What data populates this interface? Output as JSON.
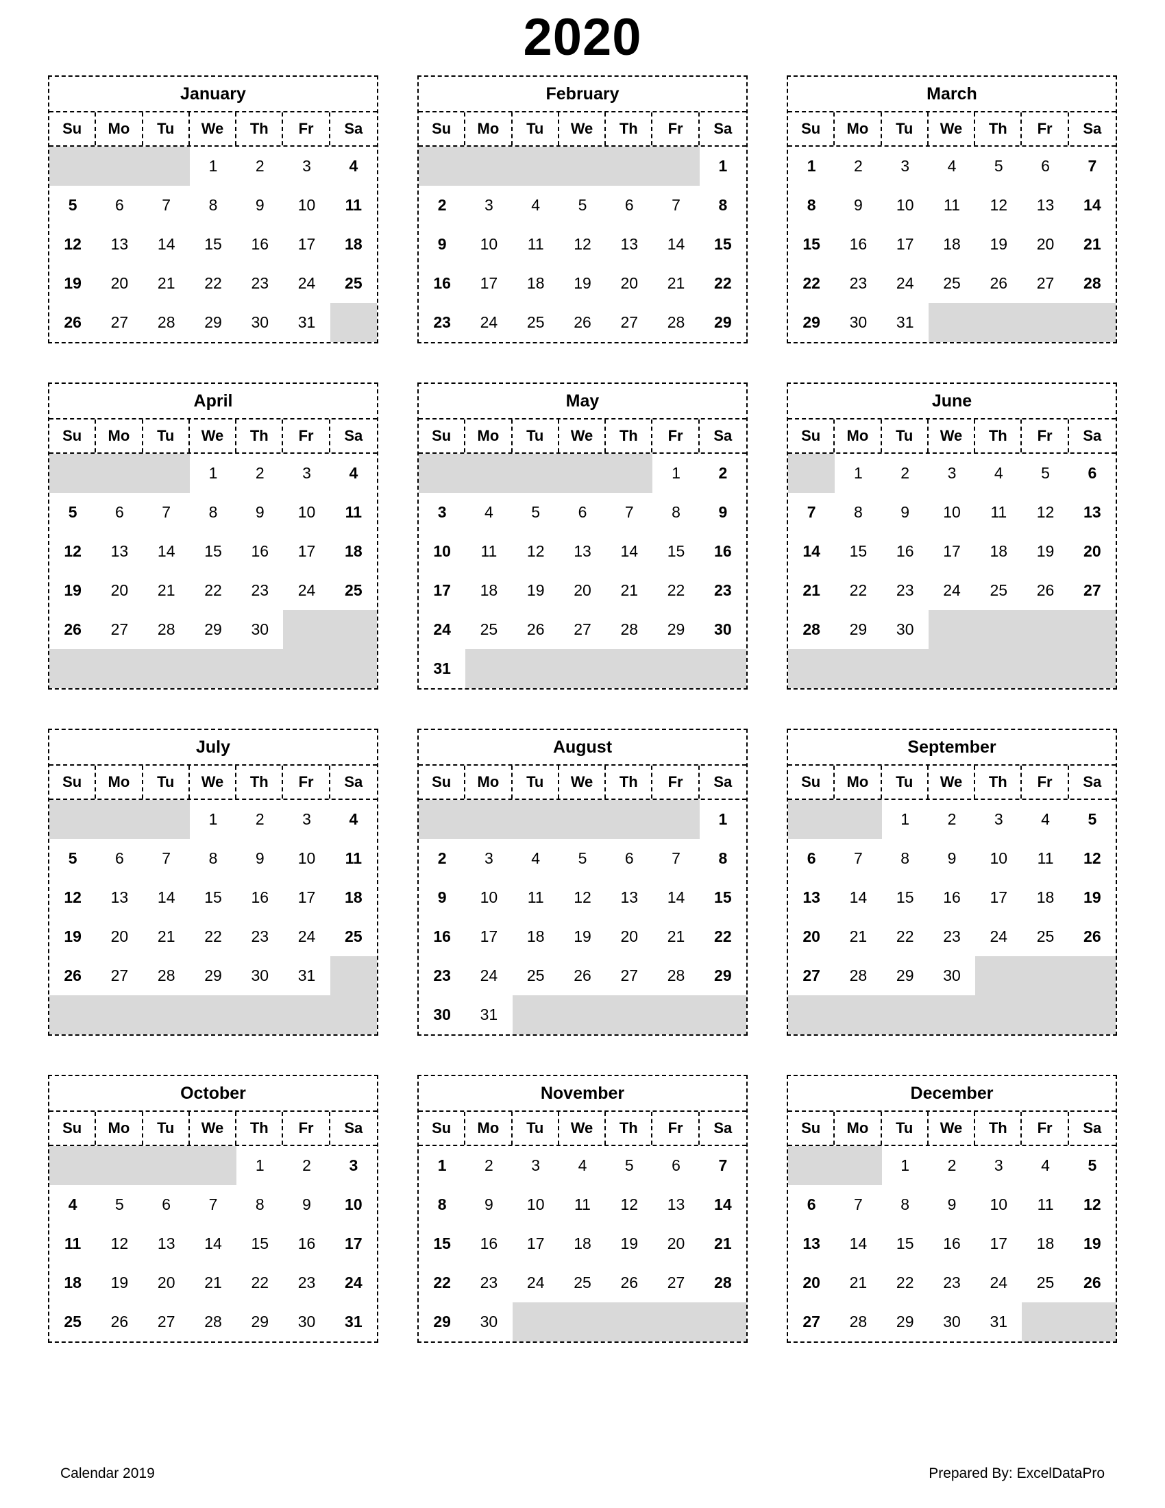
{
  "title": "2020",
  "footer": {
    "left_text": "Calendar 2019",
    "right_text": "Prepared By: ExcelDataPro"
  },
  "colors": {
    "blank_cell": "#d9d9d9",
    "text": "#000000",
    "background": "#ffffff",
    "border": "#000000"
  },
  "weekday_headers": [
    "Su",
    "Mo",
    "Tu",
    "We",
    "Th",
    "Fr",
    "Sa"
  ],
  "weekend_columns": [
    0,
    6
  ],
  "months": [
    {
      "name": "January",
      "weeks": [
        [
          "",
          "",
          "",
          "1",
          "2",
          "3",
          "4"
        ],
        [
          "5",
          "6",
          "7",
          "8",
          "9",
          "10",
          "11"
        ],
        [
          "12",
          "13",
          "14",
          "15",
          "16",
          "17",
          "18"
        ],
        [
          "19",
          "20",
          "21",
          "22",
          "23",
          "24",
          "25"
        ],
        [
          "26",
          "27",
          "28",
          "29",
          "30",
          "31",
          ""
        ]
      ]
    },
    {
      "name": "February",
      "weeks": [
        [
          "",
          "",
          "",
          "",
          "",
          "",
          "1"
        ],
        [
          "2",
          "3",
          "4",
          "5",
          "6",
          "7",
          "8"
        ],
        [
          "9",
          "10",
          "11",
          "12",
          "13",
          "14",
          "15"
        ],
        [
          "16",
          "17",
          "18",
          "19",
          "20",
          "21",
          "22"
        ],
        [
          "23",
          "24",
          "25",
          "26",
          "27",
          "28",
          "29"
        ]
      ]
    },
    {
      "name": "March",
      "weeks": [
        [
          "1",
          "2",
          "3",
          "4",
          "5",
          "6",
          "7"
        ],
        [
          "8",
          "9",
          "10",
          "11",
          "12",
          "13",
          "14"
        ],
        [
          "15",
          "16",
          "17",
          "18",
          "19",
          "20",
          "21"
        ],
        [
          "22",
          "23",
          "24",
          "25",
          "26",
          "27",
          "28"
        ],
        [
          "29",
          "30",
          "31",
          "",
          "",
          "",
          ""
        ]
      ]
    },
    {
      "name": "April",
      "weeks": [
        [
          "",
          "",
          "",
          "1",
          "2",
          "3",
          "4"
        ],
        [
          "5",
          "6",
          "7",
          "8",
          "9",
          "10",
          "11"
        ],
        [
          "12",
          "13",
          "14",
          "15",
          "16",
          "17",
          "18"
        ],
        [
          "19",
          "20",
          "21",
          "22",
          "23",
          "24",
          "25"
        ],
        [
          "26",
          "27",
          "28",
          "29",
          "30",
          "",
          ""
        ],
        [
          "",
          "",
          "",
          "",
          "",
          "",
          ""
        ]
      ]
    },
    {
      "name": "May",
      "weeks": [
        [
          "",
          "",
          "",
          "",
          "",
          "1",
          "2"
        ],
        [
          "3",
          "4",
          "5",
          "6",
          "7",
          "8",
          "9"
        ],
        [
          "10",
          "11",
          "12",
          "13",
          "14",
          "15",
          "16"
        ],
        [
          "17",
          "18",
          "19",
          "20",
          "21",
          "22",
          "23"
        ],
        [
          "24",
          "25",
          "26",
          "27",
          "28",
          "29",
          "30"
        ],
        [
          "31",
          "",
          "",
          "",
          "",
          "",
          ""
        ]
      ]
    },
    {
      "name": "June",
      "weeks": [
        [
          "",
          "1",
          "2",
          "3",
          "4",
          "5",
          "6"
        ],
        [
          "7",
          "8",
          "9",
          "10",
          "11",
          "12",
          "13"
        ],
        [
          "14",
          "15",
          "16",
          "17",
          "18",
          "19",
          "20"
        ],
        [
          "21",
          "22",
          "23",
          "24",
          "25",
          "26",
          "27"
        ],
        [
          "28",
          "29",
          "30",
          "",
          "",
          "",
          ""
        ],
        [
          "",
          "",
          "",
          "",
          "",
          "",
          ""
        ]
      ]
    },
    {
      "name": "July",
      "weeks": [
        [
          "",
          "",
          "",
          "1",
          "2",
          "3",
          "4"
        ],
        [
          "5",
          "6",
          "7",
          "8",
          "9",
          "10",
          "11"
        ],
        [
          "12",
          "13",
          "14",
          "15",
          "16",
          "17",
          "18"
        ],
        [
          "19",
          "20",
          "21",
          "22",
          "23",
          "24",
          "25"
        ],
        [
          "26",
          "27",
          "28",
          "29",
          "30",
          "31",
          ""
        ],
        [
          "",
          "",
          "",
          "",
          "",
          "",
          ""
        ]
      ]
    },
    {
      "name": "August",
      "weeks": [
        [
          "",
          "",
          "",
          "",
          "",
          "",
          "1"
        ],
        [
          "2",
          "3",
          "4",
          "5",
          "6",
          "7",
          "8"
        ],
        [
          "9",
          "10",
          "11",
          "12",
          "13",
          "14",
          "15"
        ],
        [
          "16",
          "17",
          "18",
          "19",
          "20",
          "21",
          "22"
        ],
        [
          "23",
          "24",
          "25",
          "26",
          "27",
          "28",
          "29"
        ],
        [
          "30",
          "31",
          "",
          "",
          "",
          "",
          ""
        ]
      ]
    },
    {
      "name": "September",
      "weeks": [
        [
          "",
          "",
          "1",
          "2",
          "3",
          "4",
          "5"
        ],
        [
          "6",
          "7",
          "8",
          "9",
          "10",
          "11",
          "12"
        ],
        [
          "13",
          "14",
          "15",
          "16",
          "17",
          "18",
          "19"
        ],
        [
          "20",
          "21",
          "22",
          "23",
          "24",
          "25",
          "26"
        ],
        [
          "27",
          "28",
          "29",
          "30",
          "",
          "",
          ""
        ],
        [
          "",
          "",
          "",
          "",
          "",
          "",
          ""
        ]
      ]
    },
    {
      "name": "October",
      "weeks": [
        [
          "",
          "",
          "",
          "",
          "1",
          "2",
          "3"
        ],
        [
          "4",
          "5",
          "6",
          "7",
          "8",
          "9",
          "10"
        ],
        [
          "11",
          "12",
          "13",
          "14",
          "15",
          "16",
          "17"
        ],
        [
          "18",
          "19",
          "20",
          "21",
          "22",
          "23",
          "24"
        ],
        [
          "25",
          "26",
          "27",
          "28",
          "29",
          "30",
          "31"
        ]
      ]
    },
    {
      "name": "November",
      "weeks": [
        [
          "1",
          "2",
          "3",
          "4",
          "5",
          "6",
          "7"
        ],
        [
          "8",
          "9",
          "10",
          "11",
          "12",
          "13",
          "14"
        ],
        [
          "15",
          "16",
          "17",
          "18",
          "19",
          "20",
          "21"
        ],
        [
          "22",
          "23",
          "24",
          "25",
          "26",
          "27",
          "28"
        ],
        [
          "29",
          "30",
          "",
          "",
          "",
          "",
          ""
        ]
      ]
    },
    {
      "name": "December",
      "weeks": [
        [
          "",
          "",
          "1",
          "2",
          "3",
          "4",
          "5"
        ],
        [
          "6",
          "7",
          "8",
          "9",
          "10",
          "11",
          "12"
        ],
        [
          "13",
          "14",
          "15",
          "16",
          "17",
          "18",
          "19"
        ],
        [
          "20",
          "21",
          "22",
          "23",
          "24",
          "25",
          "26"
        ],
        [
          "27",
          "28",
          "29",
          "30",
          "31",
          "",
          ""
        ]
      ]
    }
  ]
}
